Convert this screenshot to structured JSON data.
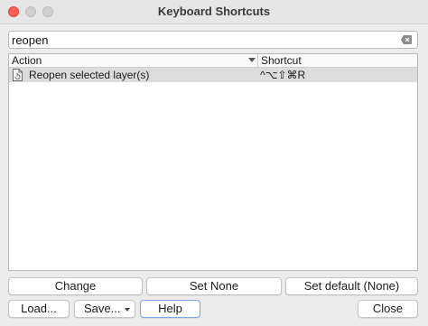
{
  "window": {
    "title": "Keyboard Shortcuts"
  },
  "search": {
    "value": "reopen",
    "clear_icon": "clear-text-icon"
  },
  "table": {
    "columns": [
      "Action",
      "Shortcut"
    ],
    "rows": [
      {
        "icon": "document-refresh-icon",
        "action": "Reopen selected layer(s)",
        "shortcut": "^⌥⇧⌘R"
      }
    ]
  },
  "buttons": {
    "change": "Change",
    "set_none": "Set None",
    "set_default": "Set default (None)",
    "load": "Load...",
    "save": "Save...",
    "help": "Help",
    "close": "Close"
  },
  "colors": {
    "close_light": "#ff5f57",
    "selection": "#dcdcdc",
    "focus_ring": "#7aa7e8"
  }
}
